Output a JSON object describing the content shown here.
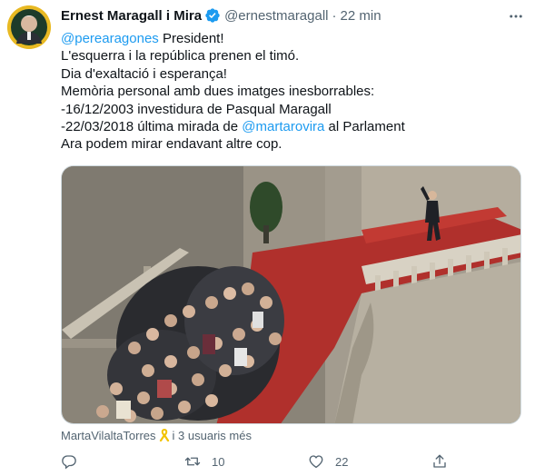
{
  "tweet": {
    "author": {
      "name": "Ernest Maragall i Mira",
      "handle": "@ernestmaragall",
      "time": "22 min",
      "verified": true,
      "avatar_icon": "profile-photo"
    },
    "text": {
      "line1_mention": "@perearagones",
      "line1_rest": " President!",
      "line2": "L'esquerra i la república prenen el timó.",
      "line3": "Dia d'exaltació i esperança!",
      "line4": "Memòria personal amb dues imatges inesborrables:",
      "line5": "-16/12/2003 investidura de Pasqual Maragall",
      "line6_pre": "-22/03/2018 última mirada de ",
      "line6_mention": "@martarovira",
      "line6_post": " al Parlament",
      "line7": "Ara podem mirar endavant altre cop."
    },
    "media": {
      "type": "photo",
      "icon": "parliament-staircase-photo"
    },
    "tagged": {
      "user": "MartaVilaltaTorres",
      "ribbon_icon": "yellow-ribbon-icon",
      "others": "i 3 usuaris més"
    },
    "actions": {
      "reply_icon": "reply-icon",
      "retweet_icon": "retweet-icon",
      "retweet_count": "10",
      "like_icon": "heart-icon",
      "like_count": "22",
      "share_icon": "share-icon"
    },
    "colors": {
      "accent": "#1d9bf0",
      "secondary_text": "#536471",
      "primary_text": "#0f1419"
    }
  }
}
